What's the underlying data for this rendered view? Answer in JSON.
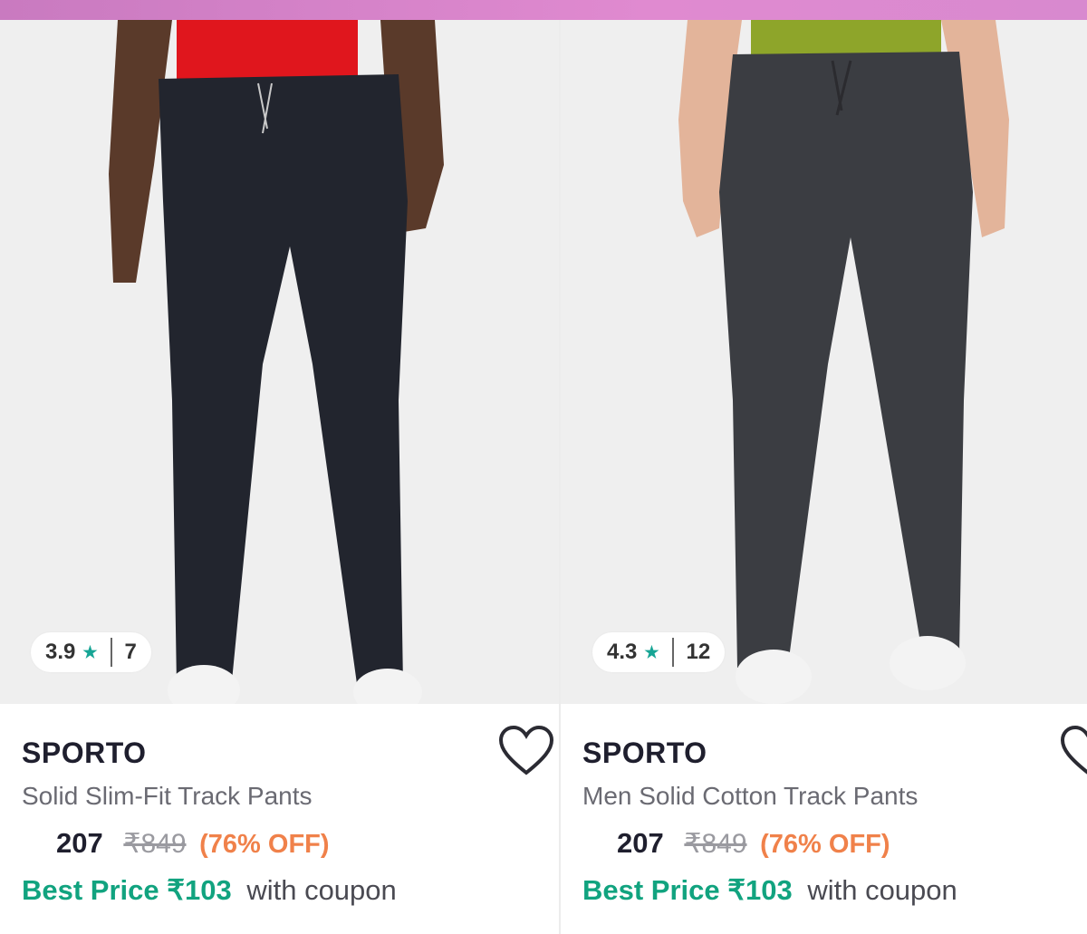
{
  "products": [
    {
      "rating": "3.9",
      "rating_count": "7",
      "brand": "SPORTO",
      "title": "Solid Slim-Fit Track Pants",
      "price": "207",
      "mrp": "₹849",
      "discount": "(76% OFF)",
      "best_price_label": "Best Price ₹103",
      "best_price_suffix": "with coupon",
      "top_color": "#e0161d",
      "pant_color": "#22252e"
    },
    {
      "rating": "4.3",
      "rating_count": "12",
      "brand": "SPORTO",
      "title": "Men Solid Cotton Track Pants",
      "price": "207",
      "mrp": "₹849",
      "discount": "(76% OFF)",
      "best_price_label": "Best Price ₹103",
      "best_price_suffix": "with coupon",
      "top_color": "#8ea52a",
      "pant_color": "#3b3d42"
    }
  ],
  "icons": {
    "rating": "star-icon",
    "wishlist": "heart-icon"
  },
  "colors": {
    "accent_teal": "#17a595",
    "discount_orange": "#f0814a",
    "best_price_green": "#11a37f"
  }
}
